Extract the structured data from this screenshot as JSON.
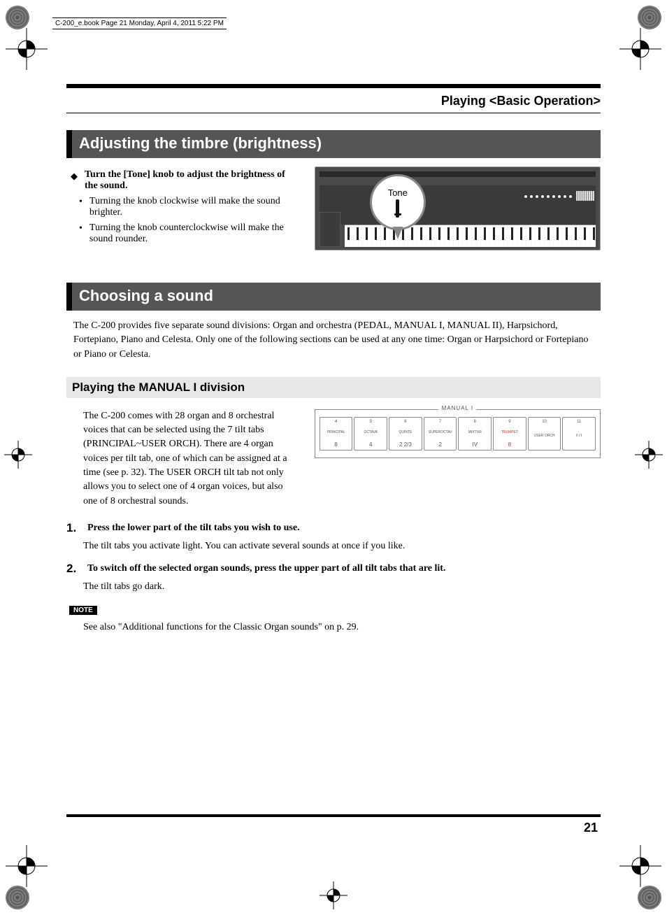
{
  "header_line": "C-200_e.book  Page 21  Monday, April 4, 2011  5:22 PM",
  "page_title": "Playing <Basic Operation>",
  "page_number": "21",
  "section1": {
    "heading": "Adjusting the timbre (brightness)",
    "lead": "Turn the [Tone] knob to adjust the brightness of the sound.",
    "bullets": [
      "Turning the knob clockwise will make the sound brighter.",
      "Turning the knob counterclockwise will make the sound rounder."
    ],
    "tone_label": "Tone"
  },
  "section2": {
    "heading": "Choosing a sound",
    "intro": "The C-200 provides five separate sound divisions: Organ and orchestra (PEDAL, MANUAL I, MANUAL II), Harpsichord, Fortepiano, Piano and Celesta. Only one of the following sections can be used at any one time: Organ or Harpsichord or Fortepiano or Piano or Celesta."
  },
  "subsection": {
    "heading": "Playing the MANUAL I division",
    "intro": "The C-200 comes with 28 organ and 8 orchestral voices that can be selected using the 7 tilt tabs (PRINCIPAL~USER ORCH). There are 4 organ voices per tilt tab, one of which can be assigned at a time (see p. 32). The USER ORCH tilt tab not only allows you to select one of 4 organ voices, but also one of 8 orchestral sounds.",
    "panel_label": "MANUAL I",
    "tabs": [
      {
        "num": "4",
        "name": "PRINCIPAL",
        "foot": "8"
      },
      {
        "num": "5",
        "name": "OCTAVA",
        "foot": "4"
      },
      {
        "num": "6",
        "name": "QUINTE",
        "foot": "2 2/3"
      },
      {
        "num": "7",
        "name": "SUPEROCTAV",
        "foot": "2"
      },
      {
        "num": "8",
        "name": "MIXTUR",
        "foot": "IV"
      },
      {
        "num": "9",
        "name": "TRUMPET",
        "foot": "8",
        "red": true
      },
      {
        "num": "10",
        "name": "USER ORCH",
        "foot": ""
      },
      {
        "num": "11",
        "name": "II / I",
        "foot": ""
      }
    ],
    "steps": [
      {
        "num": "1.",
        "bold": "Press the lower part of the tilt tabs you wish to use.",
        "body": "The tilt tabs you activate light. You can activate several sounds at once if you like."
      },
      {
        "num": "2.",
        "bold": "To switch off the selected organ sounds, press the upper part of all tilt tabs that are lit.",
        "body": "The tilt tabs go dark."
      }
    ],
    "note_label": "NOTE",
    "note_body": "See also \"Additional functions for the Classic Organ sounds\" on p. 29."
  }
}
